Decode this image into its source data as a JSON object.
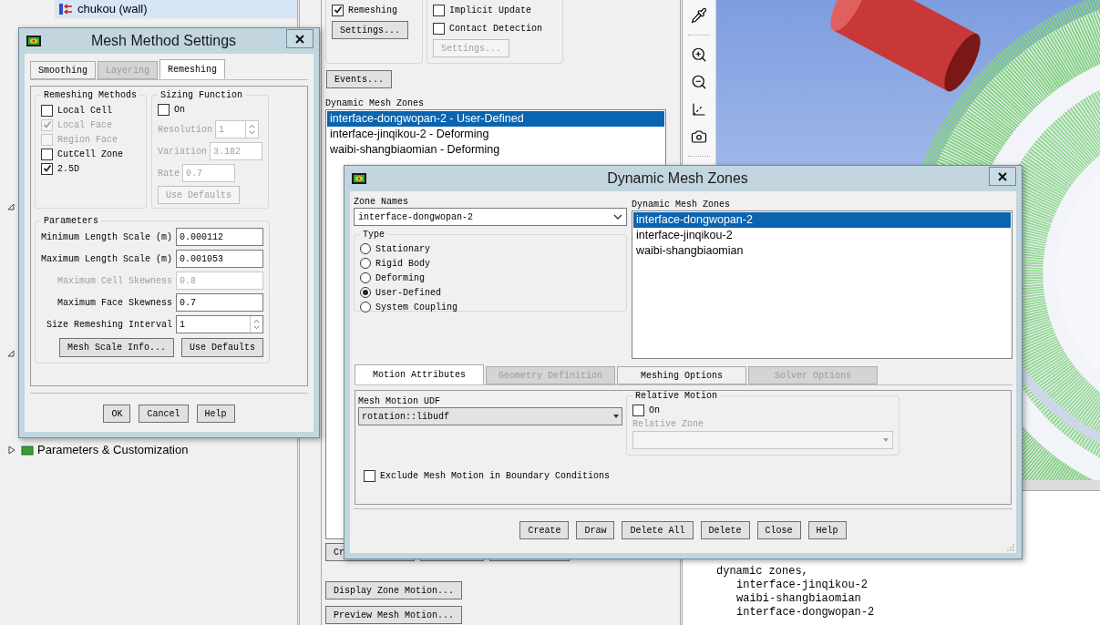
{
  "tree": {
    "items": [
      {
        "label": "chukou (wall)",
        "selected": true,
        "kind": "boundary"
      },
      {
        "label": "Parameters & Customization",
        "selected": false,
        "kind": "section"
      }
    ]
  },
  "mesh_panel": {
    "option_groups": [
      {
        "options": [
          {
            "label": "Remeshing",
            "checked": true
          }
        ],
        "button": {
          "label": "Settings...",
          "disabled": false
        }
      },
      {
        "options": [
          {
            "label": "Implicit Update",
            "checked": false
          },
          {
            "label": "Contact Detection",
            "checked": false
          }
        ],
        "button": {
          "label": "Settings...",
          "disabled": true
        }
      }
    ],
    "events_button": "Events...",
    "zones_label": "Dynamic Mesh Zones",
    "zones": [
      {
        "label": "interface-dongwopan-2 - User-Defined",
        "selected": true
      },
      {
        "label": "interface-jinqikou-2 - Deforming",
        "selected": false
      },
      {
        "label": "waibi-shangbiaomian - Deforming",
        "selected": false
      }
    ],
    "zone_button": "Cr",
    "motion_buttons": [
      "Display Zone Motion...",
      "Preview Mesh Motion..."
    ]
  },
  "console": {
    "lines": [
      {
        "text": "dynamic zones,",
        "children": [
          {
            "text": "interface-jinqikou-2"
          },
          {
            "text": "waibi-shangbiaomian"
          },
          {
            "text": "interface-dongwopan-2"
          }
        ]
      }
    ]
  },
  "mesh_method_settings": {
    "title": "Mesh Method Settings",
    "tabs": [
      {
        "label": "Smoothing",
        "selected": false,
        "disabled": false
      },
      {
        "label": "Layering",
        "selected": false,
        "disabled": true
      },
      {
        "label": "Remeshing",
        "selected": true,
        "disabled": false
      }
    ],
    "remeshing_methods": {
      "title": "Remeshing Methods",
      "options": [
        {
          "label": "Local Cell",
          "checked": false,
          "disabled": false
        },
        {
          "label": "Local Face",
          "checked": true,
          "disabled": true
        },
        {
          "label": "Region Face",
          "checked": false,
          "disabled": true
        },
        {
          "label": "CutCell Zone",
          "checked": false,
          "disabled": false
        },
        {
          "label": "2.5D",
          "checked": true,
          "disabled": false
        }
      ]
    },
    "sizing_function": {
      "title": "Sizing Function",
      "on_label": "On",
      "on": false,
      "fields": [
        {
          "label": "Resolution",
          "value": "1",
          "kind": "spinner"
        },
        {
          "label": "Variation",
          "value": "3.182",
          "kind": "text"
        },
        {
          "label": "Rate",
          "value": "0.7",
          "kind": "text"
        }
      ],
      "button": "Use Defaults"
    },
    "parameters": {
      "title": "Parameters",
      "fields": [
        {
          "label": "Minimum Length Scale (m)",
          "value": "0.000112",
          "disabled": false,
          "kind": "text"
        },
        {
          "label": "Maximum Length Scale (m)",
          "value": "0.001053",
          "disabled": false,
          "kind": "text"
        },
        {
          "label": "Maximum Cell Skewness",
          "value": "0.8",
          "disabled": true,
          "kind": "text"
        },
        {
          "label": "Maximum Face Skewness",
          "value": "0.7",
          "disabled": false,
          "kind": "text"
        },
        {
          "label": "Size Remeshing Interval",
          "value": "1",
          "disabled": false,
          "kind": "spinner"
        }
      ],
      "buttons": [
        "Mesh Scale Info...",
        "Use Defaults"
      ]
    },
    "buttons": [
      "OK",
      "Cancel",
      "Help"
    ]
  },
  "zones_dialog": {
    "title": "Dynamic Mesh Zones",
    "zone_names_label": "Zone Names",
    "zone_name": "interface-dongwopan-2",
    "type": {
      "title": "Type",
      "options": [
        {
          "label": "Stationary",
          "selected": false
        },
        {
          "label": "Rigid Body",
          "selected": false
        },
        {
          "label": "Deforming",
          "selected": false
        },
        {
          "label": "User-Defined",
          "selected": true
        },
        {
          "label": "System Coupling",
          "selected": false
        }
      ]
    },
    "list_label": "Dynamic Mesh Zones",
    "zones": [
      {
        "label": "interface-dongwopan-2",
        "selected": true
      },
      {
        "label": "interface-jinqikou-2",
        "selected": false
      },
      {
        "label": "waibi-shangbiaomian",
        "selected": false
      }
    ],
    "tabs": [
      {
        "label": "Motion Attributes",
        "selected": true,
        "disabled": false
      },
      {
        "label": "Geometry Definition",
        "selected": false,
        "disabled": true
      },
      {
        "label": "Meshing Options",
        "selected": false,
        "disabled": false
      },
      {
        "label": "Solver Options",
        "selected": false,
        "disabled": true
      }
    ],
    "udf_label": "Mesh Motion UDF",
    "udf_value": "rotation::libudf",
    "relative_motion": {
      "title": "Relative Motion",
      "on_label": "On",
      "on": false,
      "zone_label": "Relative Zone"
    },
    "exclude": {
      "label": "Exclude Mesh Motion in Boundary Conditions",
      "checked": false
    },
    "buttons": [
      "Create",
      "Draw",
      "Delete All",
      "Delete",
      "Close",
      "Help"
    ]
  }
}
